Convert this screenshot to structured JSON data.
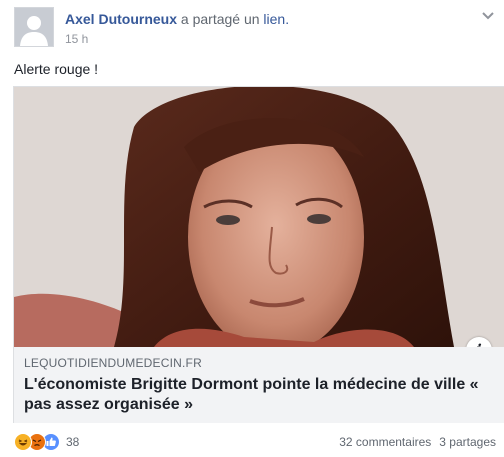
{
  "header": {
    "author": "Axel Dutourneux",
    "shared_text": "a partagé un",
    "link_word": "lien.",
    "timestamp": "15 h"
  },
  "post": {
    "text": "Alerte rouge !"
  },
  "link_preview": {
    "domain": "LEQUOTIDIENDUMEDECIN.FR",
    "headline": "L'économiste Brigitte Dormont pointe la médecine de ville « pas assez organisée »",
    "info_glyph": "i"
  },
  "footer": {
    "reactions": [
      "haha-icon",
      "angry-icon",
      "like-icon"
    ],
    "reaction_count": "38",
    "comments": "32 commentaires",
    "shares": "3 partages"
  },
  "colors": {
    "link_blue": "#365899",
    "meta_gray": "#90949c",
    "preview_bg": "#f2f3f5"
  }
}
